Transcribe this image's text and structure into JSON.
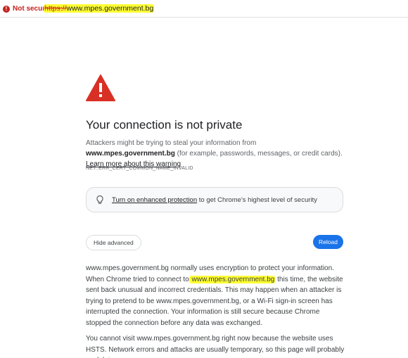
{
  "address_bar": {
    "security_label": "Not secure",
    "url_scheme": "https://",
    "url_host": "www.mpes.government.bg",
    "security_color": "#c5221f",
    "highlight_color": "#ffff33"
  },
  "interstitial": {
    "icon": "warning-triangle-icon",
    "icon_color": "#d93025",
    "title": "Your connection is not private",
    "message_before": "Attackers might be trying to steal your information from ",
    "message_host": "www.mpes.government.bg",
    "message_after": " (for example, passwords, messages, or credit cards). ",
    "learn_more": "Learn more about this warning",
    "error_code": "NET::ERR_CERT_COMMON_NAME_INVALID",
    "enhanced_link": "Turn on enhanced protection",
    "enhanced_rest": " to get Chrome's highest level of security",
    "hide_advanced_label": "Hide advanced",
    "reload_label": "Reload",
    "reload_color": "#1a73e8"
  },
  "advanced": {
    "p1_a": "www.mpes.government.bg normally uses encryption to protect your information. When Chrome tried to connect to",
    "p1_host": " www.mpes.government.bg",
    "p1_b": " this time, the website sent back unusual and incorrect credentials. This may happen when an attacker is trying to pretend to be www.mpes.government.bg, or a Wi-Fi sign-in screen has interrupted the connection. Your information is still secure because Chrome stopped the connection before any data was exchanged.",
    "p2": "You cannot visit www.mpes.government.bg right now because the website uses HSTS. Network errors and attacks are usually temporary, so this page will probably work later."
  }
}
